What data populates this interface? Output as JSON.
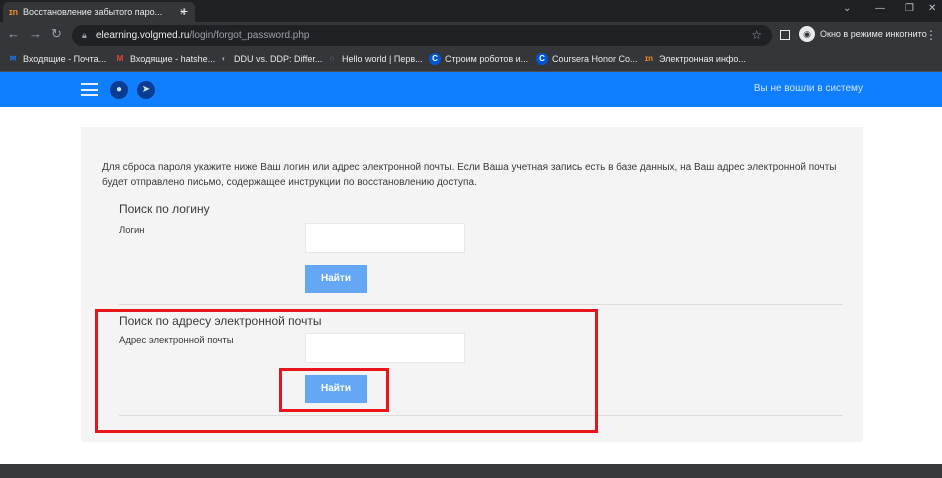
{
  "browser": {
    "tab_title": "Восстановление забытого паро...",
    "tab_favicon": "ɪn",
    "url_host": "elearning.volgmed.ru",
    "url_path": "/login/forgot_password.php",
    "incognito_label": "Окно в режиме инкогнито",
    "bookmarks": [
      {
        "icon": "gmail-icon",
        "glyph": "✉",
        "color": "#1a73e8",
        "label": "Входящие - Почта..."
      },
      {
        "icon": "gmail-icon",
        "glyph": "M",
        "color": "#ea4335",
        "label": "Входящие - hatshe..."
      },
      {
        "icon": "site-icon",
        "glyph": "◐",
        "color": "#9aa0a6",
        "label": "DDU vs. DDP: Differ..."
      },
      {
        "icon": "loader-icon",
        "glyph": "◌",
        "color": "#8ab4f8",
        "label": "Hello world | Перв..."
      },
      {
        "icon": "coursera-icon",
        "glyph": "C",
        "color": "#ffffff",
        "label": "Строим роботов и..."
      },
      {
        "icon": "coursera-icon",
        "glyph": "C",
        "color": "#ffffff",
        "label": "Coursera Honor Co..."
      },
      {
        "icon": "moodle-icon",
        "glyph": "ɪn",
        "color": "#f08a24",
        "label": "Электронная инфо..."
      }
    ]
  },
  "site": {
    "header_color": "#0f7fff",
    "login_status": "Вы не вошли в систему"
  },
  "form": {
    "instructions": "Для сброса пароля укажите ниже Ваш логин или адрес электронной почты. Если Ваша учетная запись есть в базе данных, на Ваш адрес электронной почты будет отправлено письмо, содержащее инструкции по восстановлению доступа.",
    "username_section": {
      "title": "Поиск по логину",
      "field_label": "Логин",
      "value": "",
      "button_label": "Найти"
    },
    "email_section": {
      "title": "Поиск по адресу электронной почты",
      "field_label": "Адрес электронной почты",
      "value": "",
      "button_label": "Найти"
    }
  },
  "annotation": {
    "highlight_color": "#e8161c"
  }
}
